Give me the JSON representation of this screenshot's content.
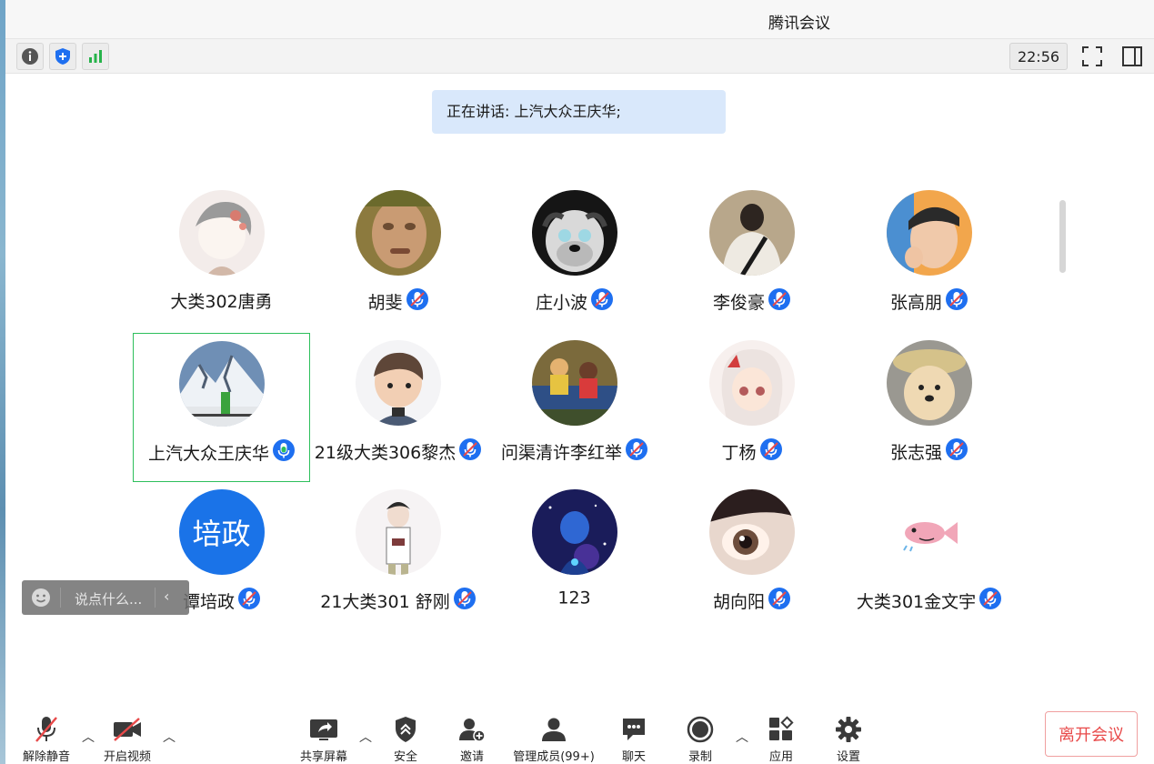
{
  "window": {
    "title": "腾讯会议"
  },
  "topbar": {
    "clock": "22:56",
    "info_icon": "info-icon",
    "shield_icon": "shield-icon",
    "signal_icon": "signal-icon"
  },
  "speaking": {
    "text": "正在讲话: 上汽大众王庆华;"
  },
  "participants": [
    {
      "name": "大类302唐勇",
      "avatar": "anime-sketch",
      "mic": "none"
    },
    {
      "name": "胡斐",
      "avatar": "face-photo",
      "mic": "muted"
    },
    {
      "name": "庄小波",
      "avatar": "dog-glasses",
      "mic": "muted"
    },
    {
      "name": "李俊豪",
      "avatar": "person-back",
      "mic": "muted"
    },
    {
      "name": "张高朋",
      "avatar": "selfie",
      "mic": "muted"
    },
    {
      "name": "上汽大众王庆华",
      "avatar": "mountain",
      "mic": "speaking"
    },
    {
      "name": "21级大类306黎杰",
      "avatar": "cartoon-boy",
      "mic": "muted"
    },
    {
      "name": "问渠清许李红举",
      "avatar": "kids-bench",
      "mic": "muted"
    },
    {
      "name": "丁杨",
      "avatar": "anime-girl",
      "mic": "muted"
    },
    {
      "name": "张志强",
      "avatar": "shiba",
      "mic": "muted"
    },
    {
      "name": "谭培政",
      "avatar": "text",
      "avatar_text": "培政",
      "mic": "muted"
    },
    {
      "name": "21大类301 舒刚",
      "avatar": "sketch-boy",
      "mic": "muted"
    },
    {
      "name": "123",
      "avatar": "space-anime",
      "mic": "none"
    },
    {
      "name": "胡向阳",
      "avatar": "eye-art",
      "mic": "muted"
    },
    {
      "name": "大类301金文宇",
      "avatar": "fish",
      "mic": "muted"
    }
  ],
  "chat": {
    "placeholder": "说点什么..."
  },
  "bottom": {
    "unmute": "解除静音",
    "video": "开启视频",
    "share": "共享屏幕",
    "security": "安全",
    "invite": "邀请",
    "members": "管理成员(99+)",
    "chat": "聊天",
    "record": "录制",
    "apps": "应用",
    "settings": "设置",
    "leave": "离开会议"
  },
  "colors": {
    "accent": "#1a73e8",
    "mic_blue": "#1e6ff0",
    "mic_green": "#2dbf5b",
    "leave_red": "#e84a4a",
    "speaking_bg": "#d9e8fb"
  }
}
